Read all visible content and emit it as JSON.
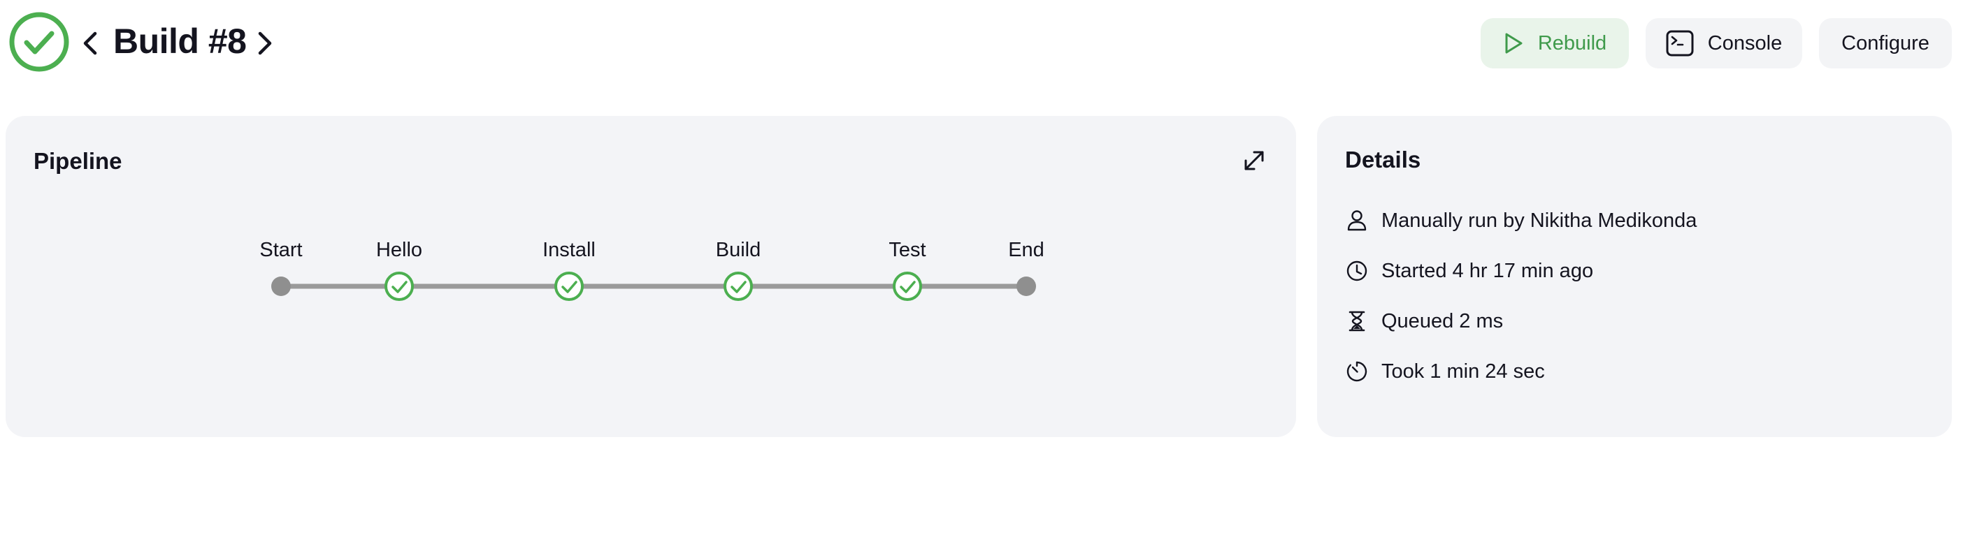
{
  "header": {
    "status_icon": "check-circle-icon",
    "status_color": "#4caf50",
    "title": "Build #8",
    "prev_icon": "chevron-left-icon",
    "next_icon": "chevron-right-icon"
  },
  "actions": {
    "rebuild": {
      "label": "Rebuild",
      "icon": "play-icon",
      "color": "#3f9a4b"
    },
    "console": {
      "label": "Console",
      "icon": "terminal-icon"
    },
    "configure": {
      "label": "Configure"
    }
  },
  "pipeline": {
    "title": "Pipeline",
    "expand_icon": "expand-icon",
    "stages": [
      {
        "label": "Start",
        "type": "endpoint"
      },
      {
        "label": "Hello",
        "type": "success"
      },
      {
        "label": "Install",
        "type": "success"
      },
      {
        "label": "Build",
        "type": "success"
      },
      {
        "label": "Test",
        "type": "success"
      },
      {
        "label": "End",
        "type": "endpoint"
      }
    ]
  },
  "details": {
    "title": "Details",
    "items": [
      {
        "icon": "user-icon",
        "text": "Manually run by Nikitha Medikonda"
      },
      {
        "icon": "clock-icon",
        "text": "Started 4 hr 17 min ago"
      },
      {
        "icon": "hourglass-icon",
        "text": "Queued 2 ms"
      },
      {
        "icon": "timer-icon",
        "text": "Took 1 min 24 sec"
      }
    ]
  }
}
